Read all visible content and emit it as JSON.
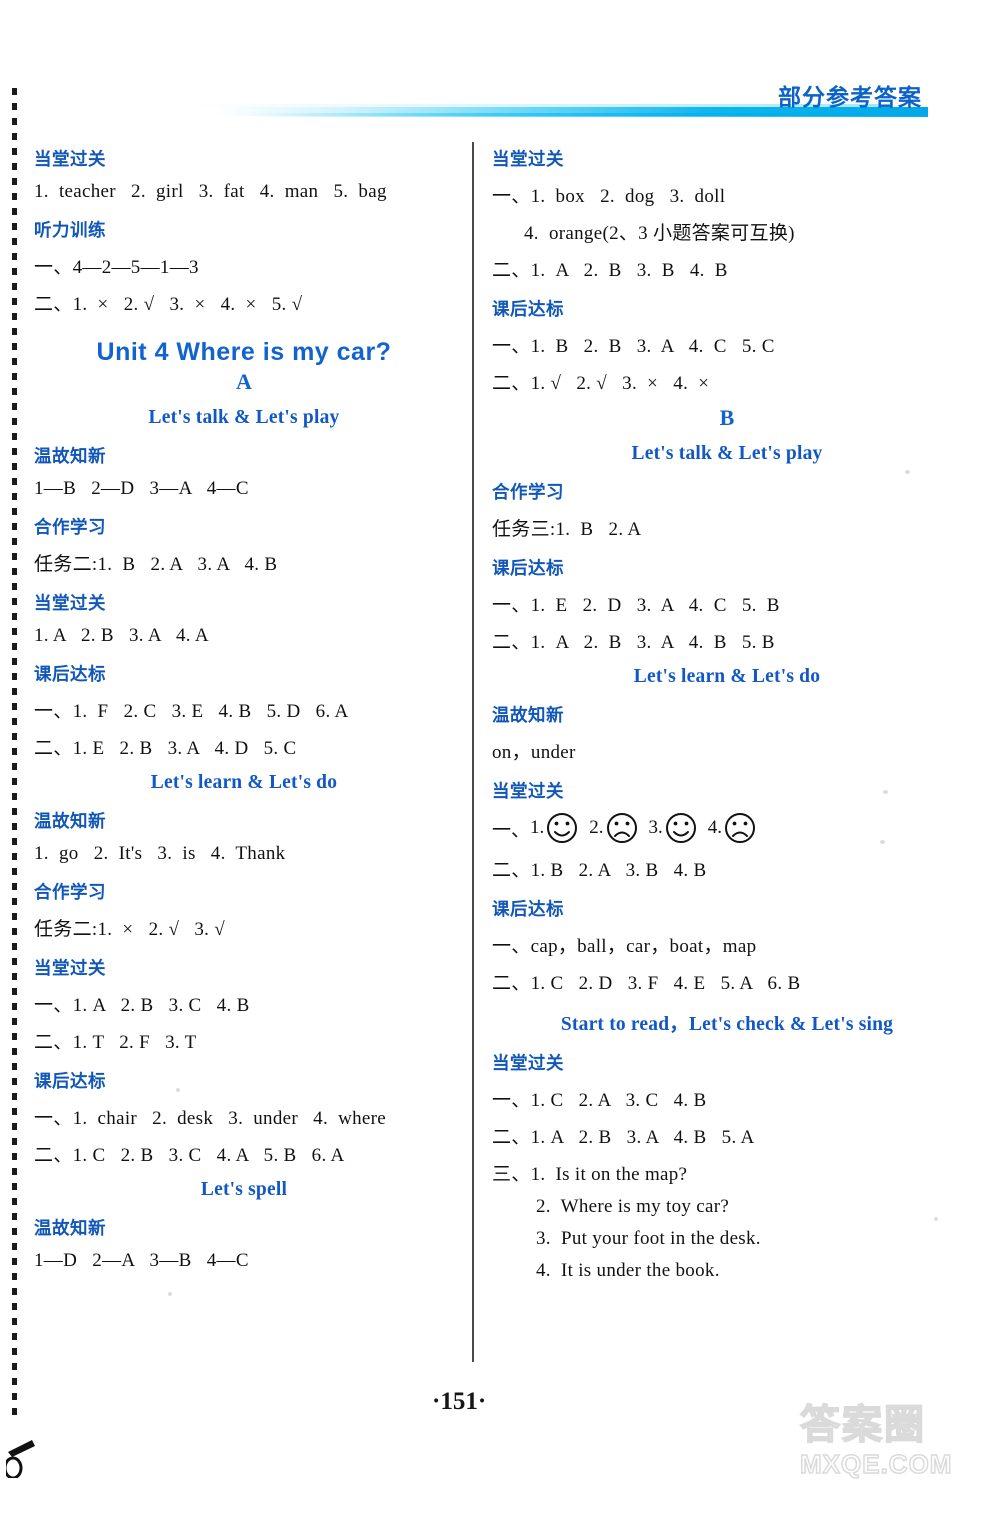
{
  "header": {
    "title": "部分参考答案"
  },
  "page_number": "·151·",
  "watermark": {
    "cn": "答案圈",
    "en": "MXQE.COM"
  },
  "left_column": {
    "blocks": [
      {
        "kind": "sec-head",
        "text": "当堂过关"
      },
      {
        "kind": "ans",
        "text": "1.  teacher   2.  girl   3.  fat   4.  man   5.  bag"
      },
      {
        "kind": "sec-head",
        "text": "听力训练"
      },
      {
        "kind": "ans",
        "text": "一、4—2—5—1—3"
      },
      {
        "kind": "ans",
        "text": "二、1.  ×   2. √   3.  ×   4.  ×   5. √"
      },
      {
        "kind": "unit-title",
        "text": "Unit 4    Where is my car?"
      },
      {
        "kind": "part-letter",
        "text": "A"
      },
      {
        "kind": "lesson-title",
        "text": "Let's talk & Let's play"
      },
      {
        "kind": "sec-head",
        "text": "温故知新"
      },
      {
        "kind": "ans",
        "text": "1—B   2—D   3—A   4—C"
      },
      {
        "kind": "sec-head",
        "text": "合作学习"
      },
      {
        "kind": "ans",
        "text": "任务二:1.  B   2. A   3. A   4. B"
      },
      {
        "kind": "sec-head",
        "text": "当堂过关"
      },
      {
        "kind": "ans",
        "text": "1. A   2. B   3. A   4. A"
      },
      {
        "kind": "sec-head",
        "text": "课后达标"
      },
      {
        "kind": "ans",
        "text": "一、1.  F   2. C   3. E   4. B   5. D   6. A"
      },
      {
        "kind": "ans",
        "text": "二、1. E   2. B   3. A   4. D   5. C"
      },
      {
        "kind": "lesson-title",
        "text": "Let's learn & Let's do"
      },
      {
        "kind": "sec-head",
        "text": "温故知新"
      },
      {
        "kind": "ans",
        "text": "1.  go   2.  It's   3.  is   4.  Thank"
      },
      {
        "kind": "sec-head",
        "text": "合作学习"
      },
      {
        "kind": "ans",
        "text": "任务二:1.  ×   2. √   3. √"
      },
      {
        "kind": "sec-head",
        "text": "当堂过关"
      },
      {
        "kind": "ans",
        "text": "一、1. A   2. B   3. C   4. B"
      },
      {
        "kind": "ans",
        "text": "二、1. T   2. F   3. T"
      },
      {
        "kind": "sec-head",
        "text": "课后达标"
      },
      {
        "kind": "ans",
        "text": "一、1.  chair   2.  desk   3.  under   4.  where"
      },
      {
        "kind": "ans",
        "text": "二、1. C   2. B   3. C   4. A   5. B   6. A"
      },
      {
        "kind": "lesson-title",
        "text": "Let's spell"
      },
      {
        "kind": "sec-head",
        "text": "温故知新"
      },
      {
        "kind": "ans",
        "text": "1—D   2—A   3—B   4—C"
      }
    ]
  },
  "right_column": {
    "blocks": [
      {
        "kind": "sec-head",
        "text": "当堂过关"
      },
      {
        "kind": "ans",
        "text": "一、1.  box   2.  dog   3.  doll"
      },
      {
        "kind": "ans-indent",
        "text": "4.  orange(2、3 小题答案可互换)"
      },
      {
        "kind": "ans",
        "text": "二、1.  A   2.  B   3.  B   4.  B"
      },
      {
        "kind": "sec-head",
        "text": "课后达标"
      },
      {
        "kind": "ans",
        "text": "一、1.  B   2.  B   3.  A   4.  C   5. C"
      },
      {
        "kind": "ans",
        "text": "二、1. √   2. √   3.  ×   4.  ×"
      },
      {
        "kind": "part-letter",
        "text": "B"
      },
      {
        "kind": "lesson-title",
        "text": "Let's talk & Let's play"
      },
      {
        "kind": "sec-head",
        "text": "合作学习"
      },
      {
        "kind": "ans",
        "text": "任务三:1.  B   2. A"
      },
      {
        "kind": "sec-head",
        "text": "课后达标"
      },
      {
        "kind": "ans",
        "text": "一、1.  E   2.  D   3.  A   4.  C   5.  B"
      },
      {
        "kind": "ans",
        "text": "二、1.  A   2.  B   3.  A   4.  B   5. B"
      },
      {
        "kind": "lesson-title",
        "text": "Let's learn & Let's do"
      },
      {
        "kind": "sec-head",
        "text": "温故知新"
      },
      {
        "kind": "ans",
        "text": "on，under"
      },
      {
        "kind": "sec-head",
        "text": "当堂过关"
      },
      {
        "kind": "faces",
        "label": "一、",
        "items": [
          {
            "n": "1.",
            "face": "happy-face-icon"
          },
          {
            "n": "2.",
            "face": "sad-face-icon"
          },
          {
            "n": "3.",
            "face": "happy-face-icon"
          },
          {
            "n": "4.",
            "face": "sad-face-icon"
          }
        ]
      },
      {
        "kind": "ans",
        "text": "二、1. B   2. A   3. B   4. B"
      },
      {
        "kind": "sec-head",
        "text": "课后达标"
      },
      {
        "kind": "ans",
        "text": "一、cap，ball，car，boat，map"
      },
      {
        "kind": "ans",
        "text": "二、1. C   2. D   3. F   4. E   5. A   6. B"
      },
      {
        "kind": "lesson-title",
        "text": "Start to read，Let's check & Let's sing"
      },
      {
        "kind": "sec-head",
        "text": "当堂过关"
      },
      {
        "kind": "ans",
        "text": "一、1. C   2. A   3. C   4. B"
      },
      {
        "kind": "ans",
        "text": "二、1. A   2. B   3. A   4. B   5. A"
      },
      {
        "kind": "ans",
        "text": "三、1.  Is it on the map?"
      },
      {
        "kind": "ans-indent2",
        "text": "2.  Where is my toy car?"
      },
      {
        "kind": "ans-indent2",
        "text": "3.  Put your foot in the desk."
      },
      {
        "kind": "ans-indent2",
        "text": "4.  It is under the book."
      }
    ]
  }
}
